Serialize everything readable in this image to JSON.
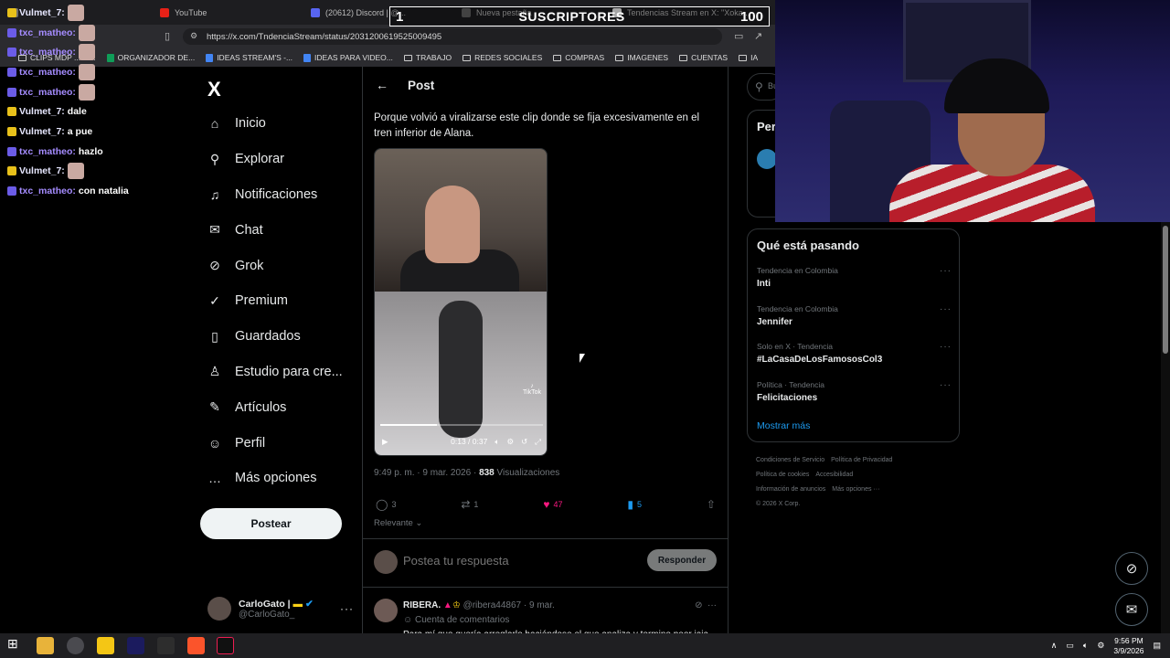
{
  "browser": {
    "tabs": [
      {
        "label": "",
        "color": "#6e6e6e"
      },
      {
        "label": "YouTube",
        "color": "#e62117"
      },
      {
        "label": "(20612) Discord | @...",
        "color": "#5865f2"
      },
      {
        "label": "Nueva pestaña",
        "color": "#666"
      },
      {
        "label": "Tendencias Stream en X: \"Xoka...",
        "color": "#fff"
      }
    ],
    "url": "https://x.com/TndenciaStream/status/2031200619525009495",
    "bookmarks": [
      {
        "label": "CLIPS MDP ... M...",
        "kind": "folder"
      },
      {
        "label": "ORGANIZADOR DE...",
        "kind": "sheet",
        "color": "#0f9d58"
      },
      {
        "label": "IDEAS STREAM'S -...",
        "kind": "doc",
        "color": "#4285f4"
      },
      {
        "label": "IDEAS PARA VIDEO...",
        "kind": "doc",
        "color": "#4285f4"
      },
      {
        "label": "TRABAJO",
        "kind": "folder"
      },
      {
        "label": "REDES SOCIALES",
        "kind": "folder"
      },
      {
        "label": "COMPRAS",
        "kind": "folder"
      },
      {
        "label": "IMAGENES",
        "kind": "folder"
      },
      {
        "label": "CUENTAS",
        "kind": "folder"
      },
      {
        "label": "IA",
        "kind": "folder"
      }
    ]
  },
  "subscribers_widget": {
    "current": "1",
    "label": "SUSCRIPTORES",
    "goal": "100"
  },
  "chat": [
    {
      "user": "Vulmet_7:",
      "msg": "",
      "emote": true,
      "style": "u1"
    },
    {
      "user": "txc_matheo:",
      "msg": "",
      "emote": true,
      "style": "u2"
    },
    {
      "user": "txc_matheo:",
      "msg": "",
      "emote": true,
      "style": "u2"
    },
    {
      "user": "txc_matheo:",
      "msg": "",
      "emote": true,
      "style": "u2"
    },
    {
      "user": "txc_matheo:",
      "msg": "",
      "emote": true,
      "style": "u2"
    },
    {
      "user": "Vulmet_7:",
      "msg": "dale",
      "emote": false,
      "style": "u1"
    },
    {
      "user": "Vulmet_7:",
      "msg": "a pue",
      "emote": false,
      "style": "u1"
    },
    {
      "user": "txc_matheo:",
      "msg": "hazlo",
      "emote": false,
      "style": "u2"
    },
    {
      "user": "Vulmet_7:",
      "msg": "",
      "emote": true,
      "style": "u1"
    },
    {
      "user": "txc_matheo:",
      "msg": "con natalia",
      "emote": false,
      "style": "u2"
    }
  ],
  "sidebar": {
    "logo": "X",
    "nav": [
      {
        "label": "Inicio",
        "icon": "home-icon",
        "glyph": "⌂"
      },
      {
        "label": "Explorar",
        "icon": "search-icon",
        "glyph": "⚲"
      },
      {
        "label": "Notificaciones",
        "icon": "bell-icon",
        "glyph": "♫"
      },
      {
        "label": "Chat",
        "icon": "mail-icon",
        "glyph": "✉"
      },
      {
        "label": "Grok",
        "icon": "grok-icon",
        "glyph": "⊘"
      },
      {
        "label": "Premium",
        "icon": "verified-icon",
        "glyph": "✓"
      },
      {
        "label": "Guardados",
        "icon": "bookmark-icon",
        "glyph": "▯"
      },
      {
        "label": "Estudio para cre...",
        "icon": "studio-icon",
        "glyph": "♙"
      },
      {
        "label": "Artículos",
        "icon": "article-icon",
        "glyph": "✎"
      },
      {
        "label": "Perfil",
        "icon": "person-icon",
        "glyph": "☺"
      },
      {
        "label": "Más opciones",
        "icon": "more-circle-icon",
        "glyph": "…"
      }
    ],
    "post_button": "Postear",
    "profile": {
      "name": "CarloGato |",
      "handle": "@CarloGato_"
    }
  },
  "post": {
    "header": "Post",
    "text": "Porque volvió a viralizarse este clip donde se fija excesivamente en el tren inferior de Alana.",
    "video": {
      "time": "0:13 / 0:37",
      "progress": 0.35,
      "watermark": "TikTok"
    },
    "time": "9:49 p. m. · 9 mar. 2026 ·",
    "views": "838",
    "views_label": "Visualizaciones",
    "stats": {
      "replies": "3",
      "reposts": "1",
      "likes": "47",
      "bookmarks": "5"
    },
    "sort": "Relevante",
    "reply_placeholder": "Postea tu respuesta",
    "reply_button": "Responder"
  },
  "reply": {
    "name": "RIBERA.",
    "handle": "@ribera44867 · 9 mar.",
    "sub": "Cuenta de comentarios",
    "text": "Para mí que quería arreglarlo haciéndose el que analiza y termino peor jaja"
  },
  "right": {
    "search_placeholder": "Bu",
    "panel_title": "Per",
    "trends_title": "Qué está pasando",
    "trends": [
      {
        "context": "Tendencia en Colombia",
        "name": "Inti"
      },
      {
        "context": "Tendencia en Colombia",
        "name": "Jennifer"
      },
      {
        "context": "Solo en X · Tendencia",
        "name": "#LaCasaDeLosFamososCol3"
      },
      {
        "context": "Política · Tendencia",
        "name": "Felicitaciones"
      }
    ],
    "show_more": "Mostrar más",
    "footer": [
      "Condiciones de Servicio",
      "Política de Privacidad",
      "Política de cookies",
      "Accesibilidad",
      "Información de anuncios",
      "Más opciones ···",
      "© 2026 X Corp."
    ]
  },
  "taskbar": {
    "time": "9:56 PM",
    "date": "3/9/2026"
  },
  "colors": {
    "accent": "#1d9bf0",
    "like": "#f91880",
    "bookmark": "#1d9bf0"
  }
}
